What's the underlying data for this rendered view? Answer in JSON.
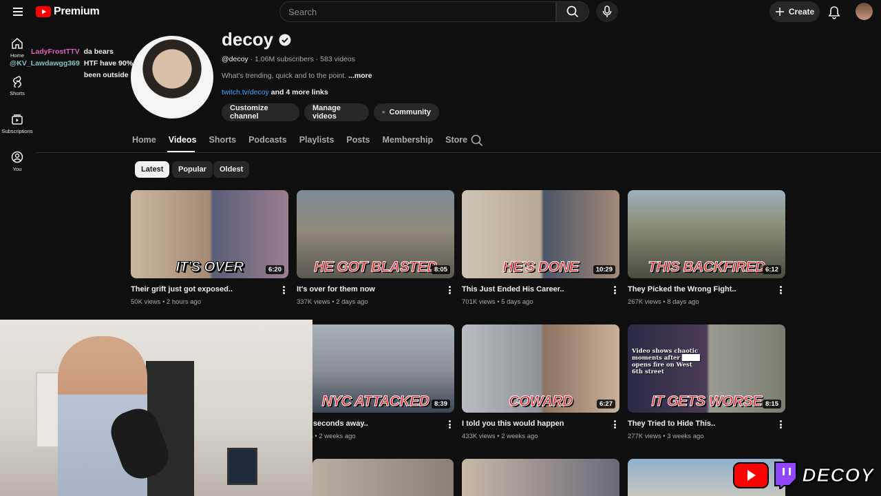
{
  "app": {
    "brand": "Premium"
  },
  "search": {
    "placeholder": "Search"
  },
  "topbar": {
    "create_label": "Create"
  },
  "rail": [
    {
      "label": "Home"
    },
    {
      "label": "Shorts"
    },
    {
      "label": "Subscriptions"
    },
    {
      "label": "You"
    }
  ],
  "chat": [
    {
      "user": "LadyFrostTTV",
      "user_color": "#e05fbf",
      "message": "da bears"
    },
    {
      "user": "@KV_Lawdawgg369",
      "user_color": "#7fc4c4",
      "message": "HTF have 90% of spiders never been outside 😩"
    }
  ],
  "channel": {
    "name": "decoy",
    "handle": "@decoy",
    "subscribers": "1.06M subscribers",
    "videos": "583 videos",
    "description": "What's trending, quick and to the point.",
    "more": "...more",
    "link": "twitch.tv/decoy",
    "more_links": "and 4 more links",
    "buttons": {
      "customize": "Customize channel",
      "manage": "Manage videos",
      "community": "Community"
    }
  },
  "tabs": [
    "Home",
    "Videos",
    "Shorts",
    "Podcasts",
    "Playlists",
    "Posts",
    "Membership",
    "Store"
  ],
  "active_tab": "Videos",
  "filters": [
    "Latest",
    "Popular",
    "Oldest"
  ],
  "videos": [
    {
      "title": "Their grift just got exposed..",
      "views": "50K views",
      "age": "2 hours ago",
      "duration": "6:20",
      "caption": "IT'S OVER"
    },
    {
      "title": "It's over for them now",
      "views": "337K views",
      "age": "2 days ago",
      "duration": "8:05",
      "caption": "HE GOT BLASTED"
    },
    {
      "title": "This Just Ended His Career..",
      "views": "701K views",
      "age": "5 days ago",
      "duration": "10:29",
      "caption": "HE'S DONE"
    },
    {
      "title": "They Picked the Wrong Fight..",
      "views": "267K views",
      "age": "8 days ago",
      "duration": "6:12",
      "caption": "THIS BACKFIRED"
    },
    {
      "title": "was seconds away..",
      "views": "views",
      "age": "2 weeks ago",
      "duration": "8:39",
      "caption": "NYC ATTACKED"
    },
    {
      "title": "I told you this would happen",
      "views": "433K views",
      "age": "2 weeks ago",
      "duration": "6:27",
      "caption": "COWARD"
    },
    {
      "title": "They Tried to Hide This..",
      "views": "277K views",
      "age": "3 weeks ago",
      "duration": "8:15",
      "caption": "IT GETS WORSE",
      "subcaption": "Video shows chaotic moments after ████ opens fire on West 6th street"
    }
  ],
  "overlay": {
    "brand": "DECOY"
  },
  "colors": {
    "accent_red": "#ff0000",
    "link_blue": "#3ea6ff",
    "bg": "#0f0f0f"
  }
}
